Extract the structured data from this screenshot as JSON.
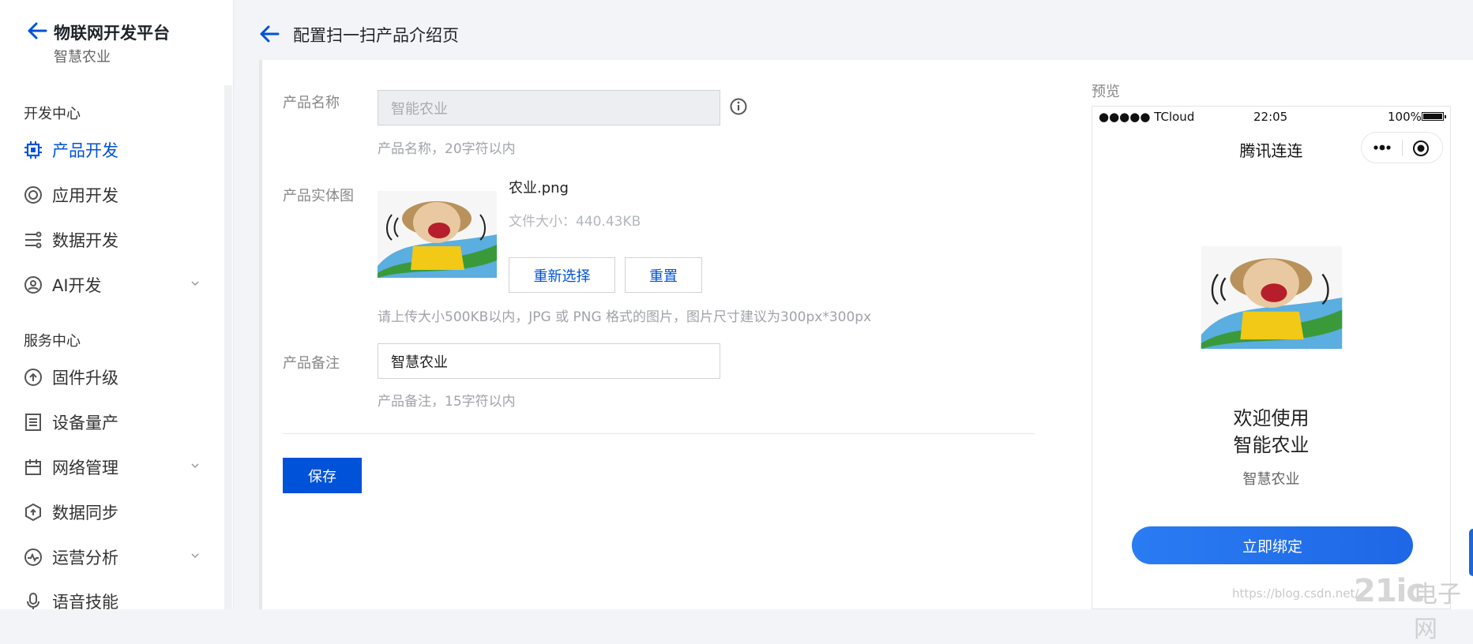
{
  "sidebar": {
    "title": "物联网开发平台",
    "subtitle": "智慧农业",
    "sections": [
      {
        "label": "开发中心"
      },
      {
        "label": "服务中心"
      }
    ],
    "items": [
      {
        "label": "产品开发",
        "icon": "chip-icon",
        "active": true
      },
      {
        "label": "应用开发",
        "icon": "app-icon"
      },
      {
        "label": "数据开发",
        "icon": "data-flow-icon"
      },
      {
        "label": "AI开发",
        "icon": "ai-icon",
        "expandable": true
      },
      {
        "label": "固件升级",
        "icon": "firmware-icon"
      },
      {
        "label": "设备量产",
        "icon": "device-batch-icon"
      },
      {
        "label": "网络管理",
        "icon": "network-icon",
        "expandable": true
      },
      {
        "label": "数据同步",
        "icon": "sync-icon"
      },
      {
        "label": "运营分析",
        "icon": "analytics-icon",
        "expandable": true
      },
      {
        "label": "语音技能",
        "icon": "voice-icon"
      }
    ]
  },
  "header": {
    "title": "配置扫一扫产品介绍页"
  },
  "form": {
    "name_label": "产品名称",
    "name_value": "智能农业",
    "name_hint": "产品名称，20字符以内",
    "image_label": "产品实体图",
    "file_name": "农业.png",
    "file_size": "文件大小：440.43KB",
    "reselect_label": "重新选择",
    "reset_label": "重置",
    "image_hint": "请上传大小500KB以内，JPG 或 PNG 格式的图片，图片尺寸建议为300px*300px",
    "note_label": "产品备注",
    "note_value": "智慧农业",
    "note_hint": "产品备注，15字符以内",
    "save_label": "保存"
  },
  "preview": {
    "label": "预览",
    "carrier": "●●●●● TCloud",
    "time": "22:05",
    "battery": "100%",
    "nav_title": "腾讯连连",
    "welcome_line1": "欢迎使用",
    "welcome_line2": "智能农业",
    "subtitle": "智慧农业",
    "bind_label": "立即绑定"
  },
  "watermark": {
    "url": "https://blog.csdn.net/",
    "logo": "21ic",
    "logo_cn": "电子网"
  },
  "colors": {
    "primary": "#0052d9",
    "accent": "#1e67e6"
  }
}
